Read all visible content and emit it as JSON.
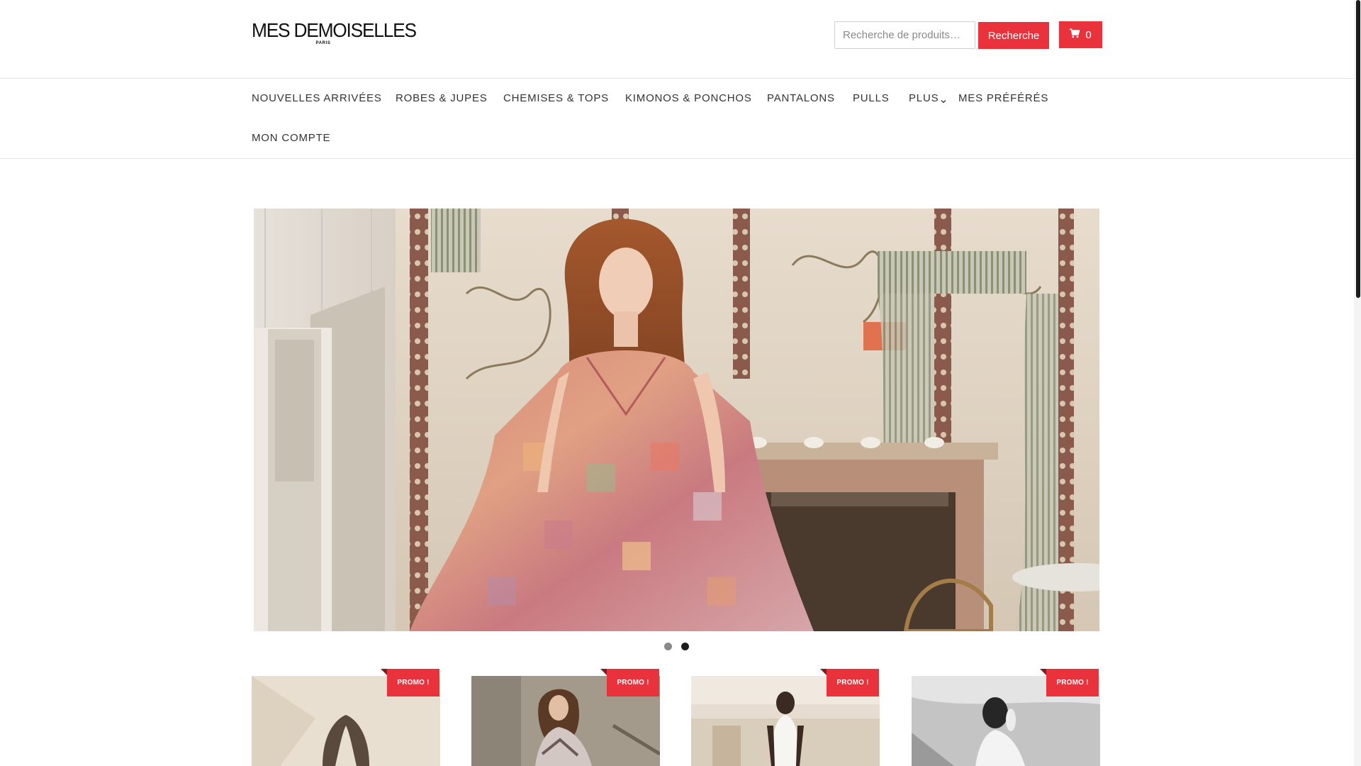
{
  "header": {
    "logo_main": "MES DEMOISELLES",
    "logo_sub": "PARIS",
    "search": {
      "placeholder": "Recherche de produits…",
      "button_label": "Recherche"
    },
    "cart": {
      "count": "0",
      "icon": "cart-icon"
    }
  },
  "nav": {
    "items": [
      {
        "label": "NOUVELLES ARRIVÉES"
      },
      {
        "label": "ROBES & JUPES"
      },
      {
        "label": "CHEMISES & TOPS"
      },
      {
        "label": "KIMONOS & PONCHOS"
      },
      {
        "label": "PANTALONS"
      },
      {
        "label": "PULLS"
      },
      {
        "label": "PLUS",
        "icon": "chevron-down-icon"
      },
      {
        "label": "MES PRÉFÉRÉS"
      },
      {
        "label": "MON COMPTE"
      }
    ]
  },
  "slider": {
    "slide_count": 2,
    "active_slide": 2
  },
  "products": [
    {
      "badge": "PROMO !"
    },
    {
      "badge": "PROMO !"
    },
    {
      "badge": "PROMO !"
    },
    {
      "badge": "PROMO !"
    }
  ],
  "colors": {
    "accent": "#e9323c",
    "text": "#333333",
    "divider": "#e4e4e4"
  }
}
